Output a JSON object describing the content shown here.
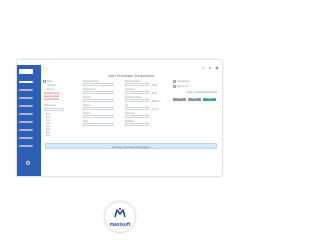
{
  "panel": {
    "title": "Add Purchase Requisition"
  },
  "header_icons": [
    "home-icon",
    "bell-icon",
    "user-icon"
  ],
  "form": {
    "col1": {
      "labels": [
        "Date",
        "Supplier",
        "Ref No"
      ],
      "red_lines": [
        "Required field",
        "Required field",
        "Required field"
      ],
      "list_header": "Warehouse",
      "list_items": [
        "Item",
        "Item",
        "Item",
        "Item",
        "Item",
        "Item",
        "Item",
        "Item"
      ]
    },
    "col2": {
      "labels": [
        "Requested By",
        "Department",
        "Priority",
        "Status",
        "Project",
        "Note"
      ]
    },
    "col3": {
      "labels": [
        "Required Date",
        "Currency",
        "Exchange Rate",
        "Tax",
        "Discount",
        "Shipping",
        "Total",
        "Paid",
        "Balance",
        "Terms"
      ]
    },
    "col4": {
      "labels": [
        "Attachment",
        "Reference"
      ],
      "green_text": "Auto Generated Number",
      "buttons": [
        "Reset",
        "Save",
        "Submit"
      ]
    }
  },
  "footer": {
    "text": "Add New Purchase Requisition"
  },
  "brand": {
    "name": "maxisoft"
  },
  "colors": {
    "sidebar": "#2f5fb5",
    "accent": "#3aa39a",
    "brand": "#1f4e9c"
  }
}
